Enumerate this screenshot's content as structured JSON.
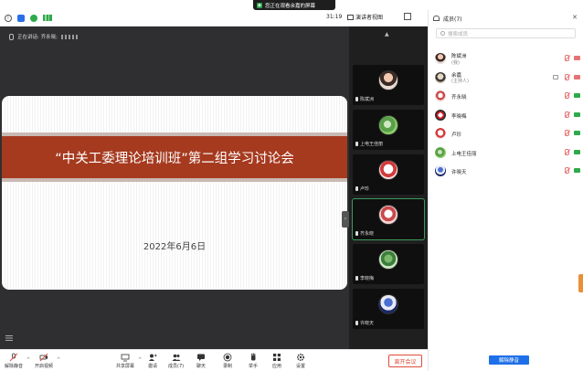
{
  "share_banner": {
    "text": "您正在观看余嘉的屏幕"
  },
  "status": {
    "timer": "31:19",
    "view_label": "演讲者视图"
  },
  "stage": {
    "speaking_label": "正在讲话: 齐永晓;",
    "slide": {
      "title": "“中关工委理论培训班”第二组学习讨论会",
      "date": "2022年6月6日"
    }
  },
  "thumbs": [
    {
      "name": "陈斌洲",
      "avatar": "a1"
    },
    {
      "name": "上电王佳丽",
      "avatar": "a5"
    },
    {
      "name": "卢珍",
      "avatar": "a3"
    },
    {
      "name": "齐永晓",
      "avatar": "a6"
    },
    {
      "name": "李晓梅",
      "avatar": "a8"
    },
    {
      "name": "许晓天",
      "avatar": "a7"
    }
  ],
  "toolbar": {
    "mute_label": "解除静音",
    "video_label": "开启视频",
    "share_label": "共享屏幕",
    "invite_label": "邀请",
    "members_label": "成员(7)",
    "chat_label": "聊天",
    "record_label": "录制",
    "raise_label": "举手",
    "apps_label": "应用",
    "settings_label": "设置",
    "leave_label": "离开会议"
  },
  "panel": {
    "title": "成员(7)",
    "search_placeholder": "搜索成员",
    "unmute_all_label": "解除静音",
    "participants": [
      {
        "name": "陈斌洲",
        "role": "(我)",
        "avatar": "a1",
        "mic_on": false,
        "cam_on": false
      },
      {
        "name": "余嘉",
        "role": "(主持人)",
        "avatar": "a2",
        "mic_on": false,
        "cam_on": false,
        "sharing": true
      },
      {
        "name": "齐永晓",
        "role": "",
        "avatar": "a6",
        "mic_on": false,
        "cam_on": true
      },
      {
        "name": "李晓梅",
        "role": "",
        "avatar": "a4",
        "mic_on": false,
        "cam_on": true
      },
      {
        "name": "卢珍",
        "role": "",
        "avatar": "a3",
        "mic_on": false,
        "cam_on": true
      },
      {
        "name": "上电王佳丽",
        "role": "",
        "avatar": "a5",
        "mic_on": false,
        "cam_on": true
      },
      {
        "name": "许晓天",
        "role": "",
        "avatar": "a7",
        "mic_on": false,
        "cam_on": true
      }
    ]
  },
  "colors": {
    "accent": "#1e6fe8",
    "slide_band": "#a63a1f",
    "leave": "#e04b3a",
    "mic_off": "#e57373",
    "cam_on": "#2eaa4a"
  }
}
